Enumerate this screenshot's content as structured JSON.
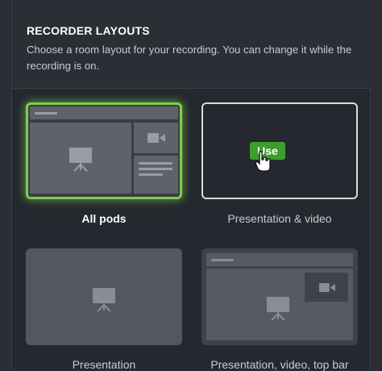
{
  "header": {
    "title": "RECORDER LAYOUTS",
    "description": "Choose a room layout for your recording. You can change it while the recording is on."
  },
  "layouts": [
    {
      "label": "All pods",
      "selected": true
    },
    {
      "label": "Presentation & video",
      "hovered": true,
      "action_label": "Use"
    },
    {
      "label": "Presentation"
    },
    {
      "label": "Presentation, video, top bar"
    }
  ],
  "colors": {
    "selected_border": "#7bd04b",
    "use_button": "#3c9e2f",
    "hover_border": "#d8dadf"
  },
  "icons": [
    "presentation-icon",
    "video-camera-icon",
    "hand-pointer-icon"
  ]
}
